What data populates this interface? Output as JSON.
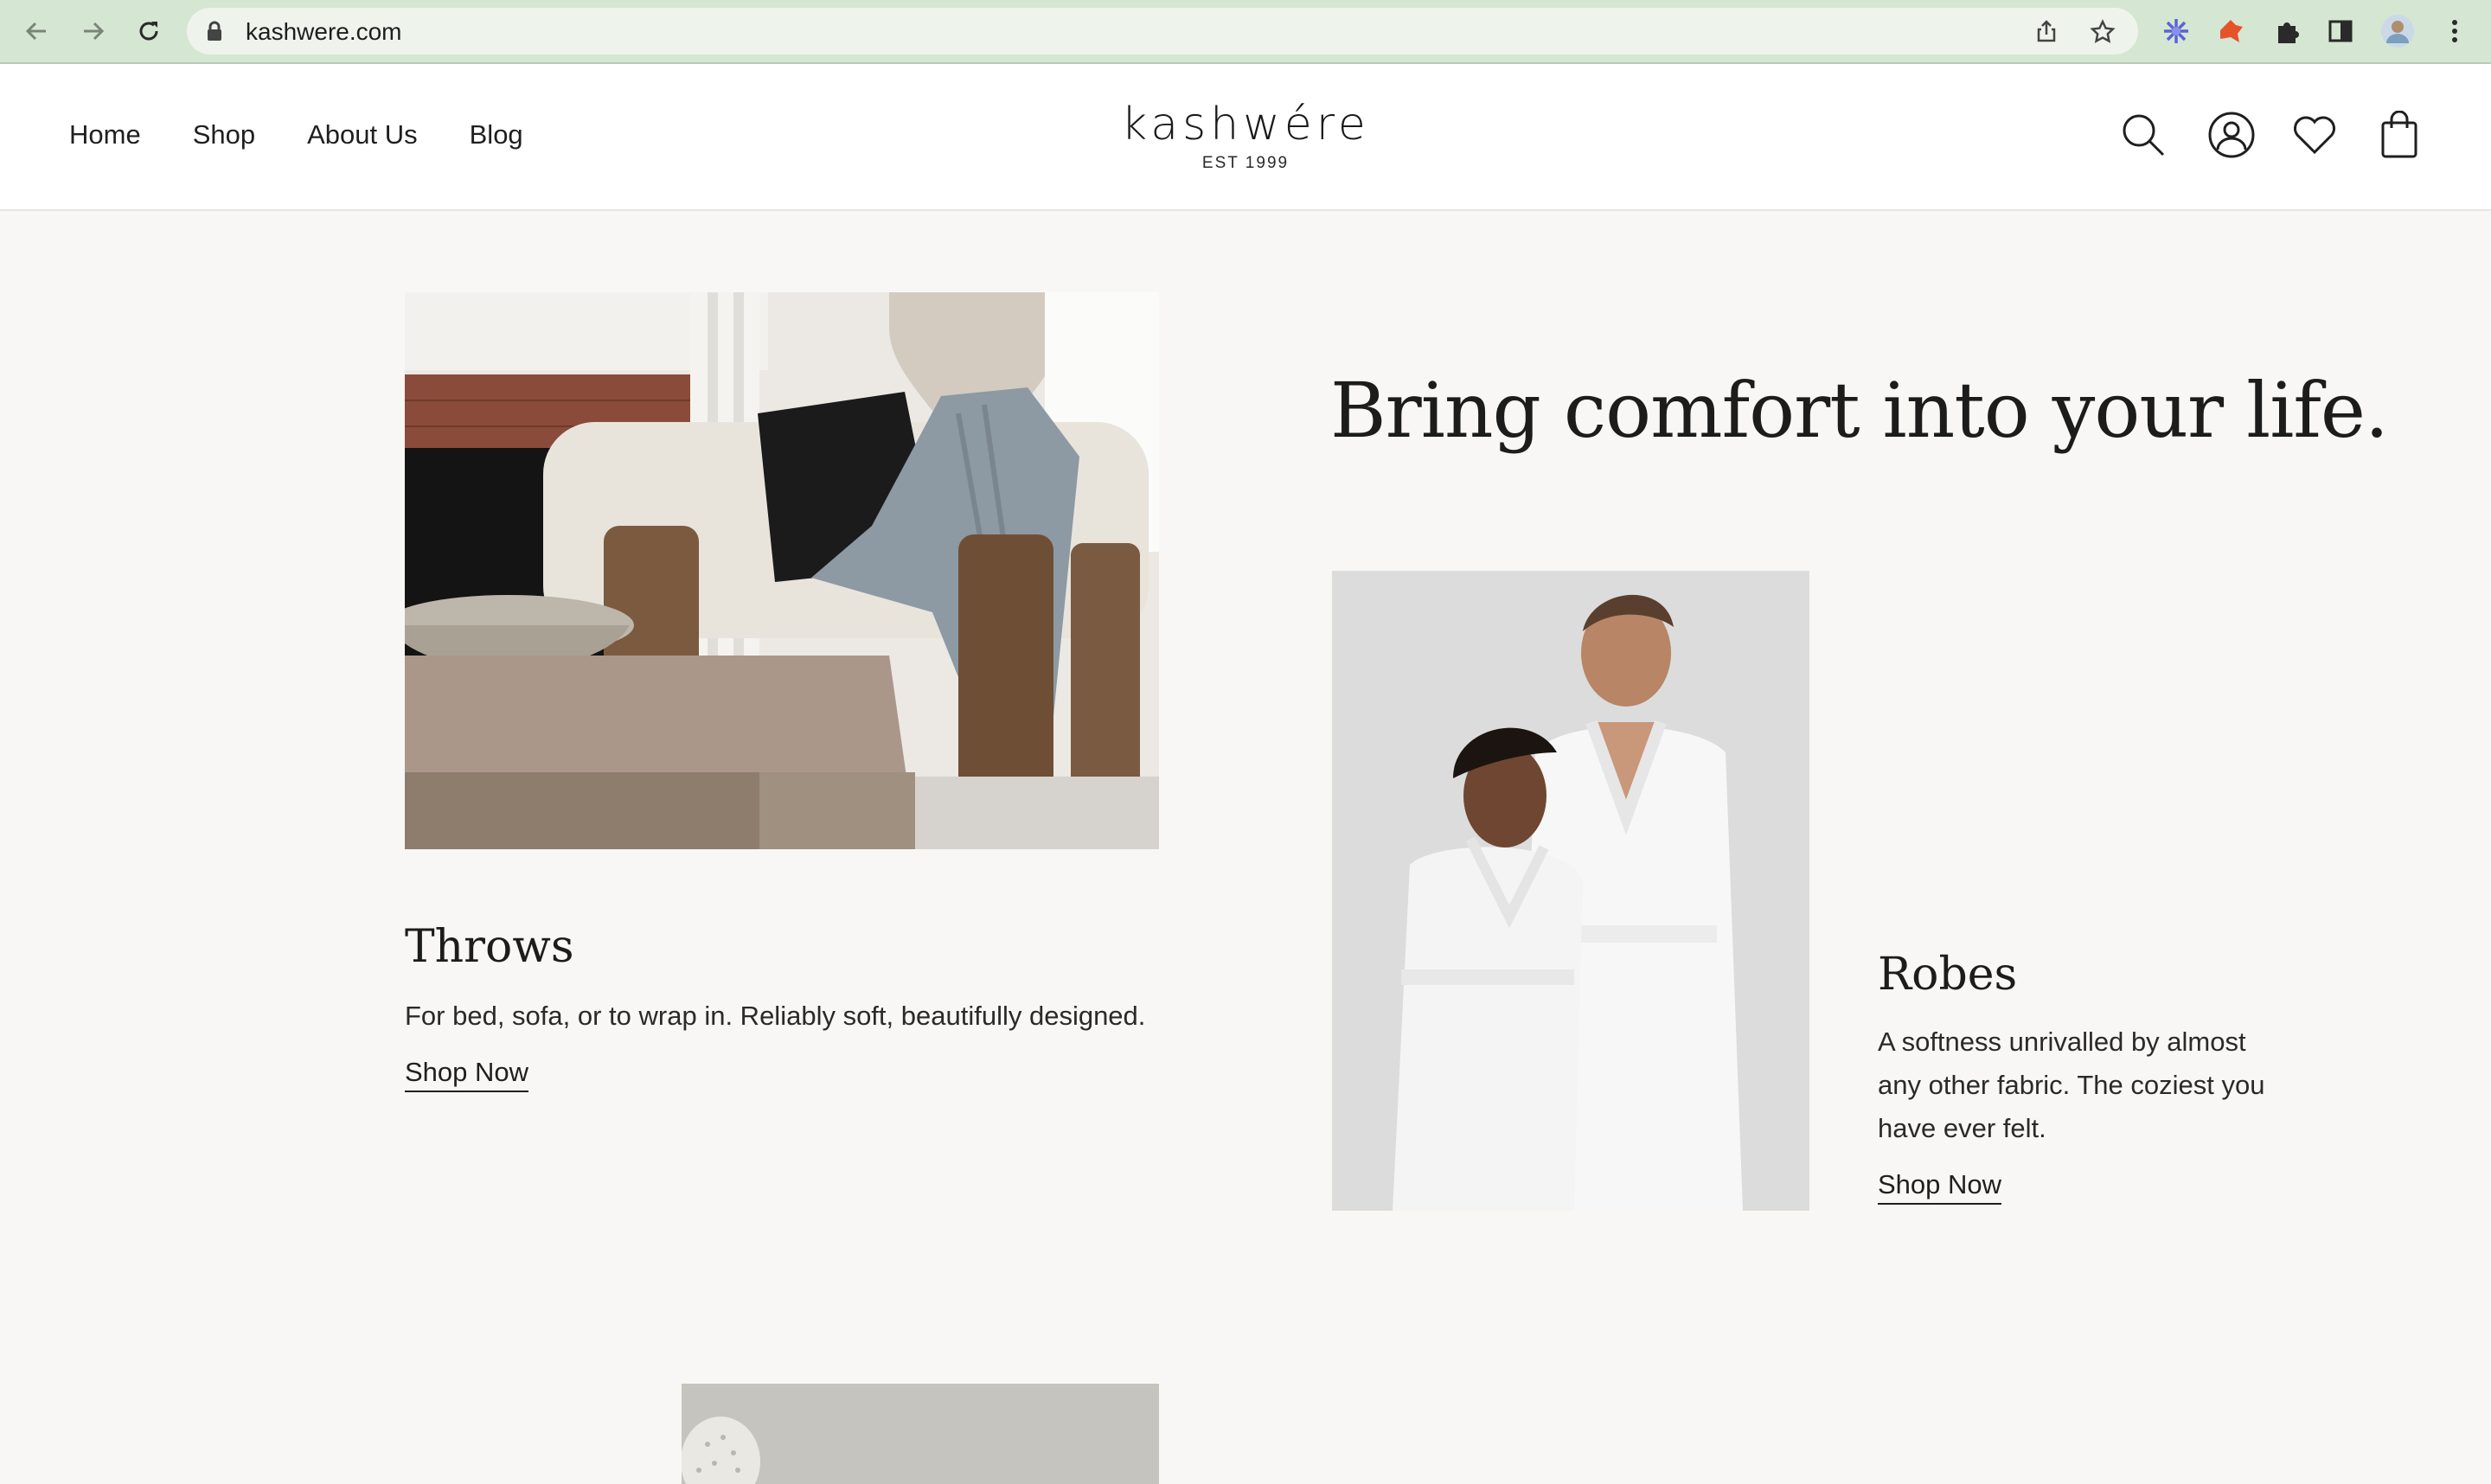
{
  "browser": {
    "url": "kashwere.com"
  },
  "header": {
    "menu": [
      "Home",
      "Shop",
      "About Us",
      "Blog"
    ],
    "logo_name": "kashwére",
    "logo_est": "EST 1999"
  },
  "hero": {
    "headline": "Bring comfort into your life."
  },
  "throws": {
    "title": "Throws",
    "description": "For bed, sofa, or to wrap in. Reliably soft, beautifully designed.",
    "link": "Shop Now"
  },
  "robes": {
    "title": "Robes",
    "description_lines": [
      "A softness unrivalled by almost",
      "any other fabric. The coziest you",
      "have ever felt."
    ],
    "link": "Shop Now"
  },
  "colors": {
    "chrome": "#d5e6d2",
    "page_bg": "#f8f7f5",
    "text": "#1f1f1f"
  }
}
